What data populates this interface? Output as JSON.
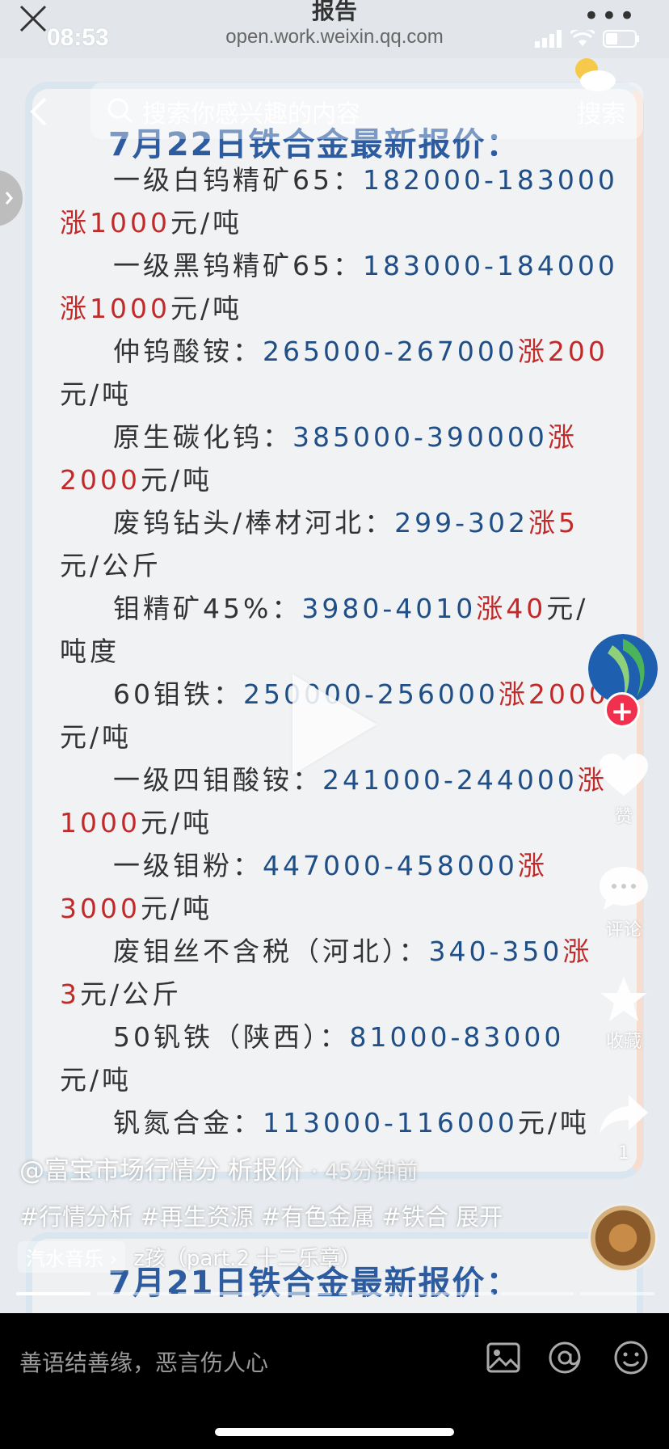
{
  "status": {
    "time": "08:53"
  },
  "window": {
    "title": "报告",
    "url": "open.work.weixin.qq.com"
  },
  "search": {
    "placeholder": "搜索你感兴趣的内容",
    "button": "搜索"
  },
  "post": {
    "title": "7月22日铁合金最新报价：",
    "lines": [
      [
        "一级白钨精矿65：",
        "182000-183000",
        "",
        ""
      ],
      [
        "",
        "",
        "涨1000",
        "元/吨"
      ],
      [
        "一级黑钨精矿65：",
        "183000-184000",
        "",
        ""
      ],
      [
        "",
        "",
        "涨1000",
        "元/吨"
      ],
      [
        "仲钨酸铵：",
        "265000-267000",
        "涨200",
        ""
      ],
      [
        "元/吨",
        "",
        "",
        ""
      ],
      [
        "原生碳化钨：",
        "385000-390000",
        "涨",
        ""
      ],
      [
        "",
        "",
        "2000",
        "元/吨"
      ],
      [
        "废钨钻头/棒材河北：",
        "299-302",
        "涨5",
        ""
      ],
      [
        "元/公斤",
        "",
        "",
        ""
      ],
      [
        "钼精矿45%：",
        "3980-4010",
        "涨40",
        "元/"
      ],
      [
        "吨度",
        "",
        "",
        ""
      ],
      [
        "60钼铁：",
        "250000-256000",
        "涨2000",
        ""
      ],
      [
        "元/吨",
        "",
        "",
        ""
      ],
      [
        "一级四钼酸铵：",
        "241000-244000",
        "涨",
        ""
      ],
      [
        "",
        "",
        "1000",
        "元/吨"
      ],
      [
        "一级钼粉：",
        "447000-458000",
        "涨",
        ""
      ],
      [
        "",
        "",
        "3000",
        "元/吨"
      ],
      [
        "废钼丝不含税（河北）：",
        "340-350",
        "涨",
        ""
      ],
      [
        "",
        "",
        "3",
        "元/公斤"
      ],
      [
        "50钒铁（陕西）：",
        "81000-83000",
        "",
        ""
      ],
      [
        "元/吨",
        "",
        "",
        ""
      ],
      [
        "钒氮合金：",
        "113000-116000",
        "",
        "元/吨"
      ]
    ],
    "next_title": "7月21日铁合金最新报价："
  },
  "author": {
    "name": "@富宝市场行情分 析报价",
    "time": "· 45分钟前"
  },
  "tags": "#行情分析 #再生资源 #有色金属 #铁合  展开",
  "music": {
    "tag": "汽水音乐 ›",
    "title": "z孩（part.2  十二乐章）"
  },
  "rail": {
    "like": "赞",
    "comment": "评论",
    "favorite": "收藏",
    "share_count": "1"
  },
  "comment_bar": {
    "placeholder": "善语结善缘，恶言伤人心"
  },
  "colors": {
    "price": "#1f4f86",
    "rise": "#c22a2a",
    "title": "#2c5b9f",
    "follow": "#f0304c"
  }
}
